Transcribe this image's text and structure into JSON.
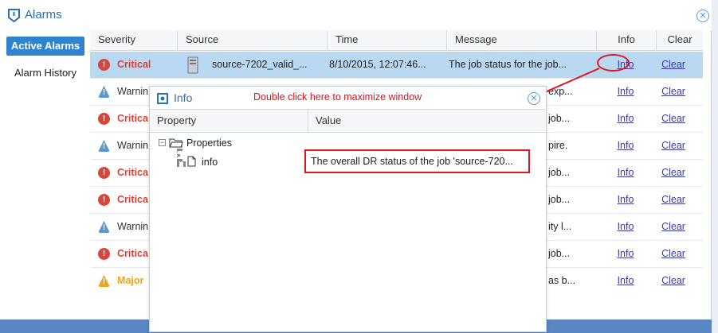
{
  "window": {
    "title": "Alarms",
    "close_icon": "close-circle-icon"
  },
  "sidebar": {
    "active_label": "Active Alarms",
    "history_label": "Alarm History"
  },
  "table": {
    "headers": {
      "severity": "Severity",
      "source": "Source",
      "time": "Time",
      "message": "Message",
      "info": "Info",
      "clear": "Clear"
    },
    "rows": [
      {
        "severity": "Critical",
        "level": "critical",
        "source": "source-7202_valid_...",
        "time": "8/10/2015, 12:07:46...",
        "message": "The job status for the job...",
        "tail": "",
        "info": "Info",
        "clear": "Clear"
      },
      {
        "severity": "Warnin",
        "level": "warning",
        "tail": "exp...",
        "info": "Info",
        "clear": "Clear"
      },
      {
        "severity": "Critica",
        "level": "critical",
        "tail": "job...",
        "info": "Info",
        "clear": "Clear"
      },
      {
        "severity": "Warnin",
        "level": "warning",
        "tail": "pire.",
        "info": "Info",
        "clear": "Clear"
      },
      {
        "severity": "Critica",
        "level": "critical",
        "tail": "job...",
        "info": "Info",
        "clear": "Clear"
      },
      {
        "severity": "Critica",
        "level": "critical",
        "tail": "job...",
        "info": "Info",
        "clear": "Clear"
      },
      {
        "severity": "Warnin",
        "level": "warning",
        "tail": "ity l...",
        "info": "Info",
        "clear": "Clear"
      },
      {
        "severity": "Critica",
        "level": "critical",
        "tail": "job...",
        "info": "Info",
        "clear": "Clear"
      },
      {
        "severity": "Major",
        "level": "major",
        "tail": "as b...",
        "info": "Info",
        "clear": "Clear"
      }
    ]
  },
  "info_window": {
    "title": "Info",
    "hint": "Double click here to maximize window",
    "headers": {
      "property": "Property",
      "value": "Value"
    },
    "tree_root": "Properties",
    "tree_child": "info",
    "value_text": "The overall DR status of the job 'source-720..."
  },
  "colors": {
    "accent": "#2f84cf",
    "critical": "#d9453b",
    "major": "#f4a21e",
    "annotation": "#e0141e",
    "selected_row": "#b9d8f2"
  }
}
